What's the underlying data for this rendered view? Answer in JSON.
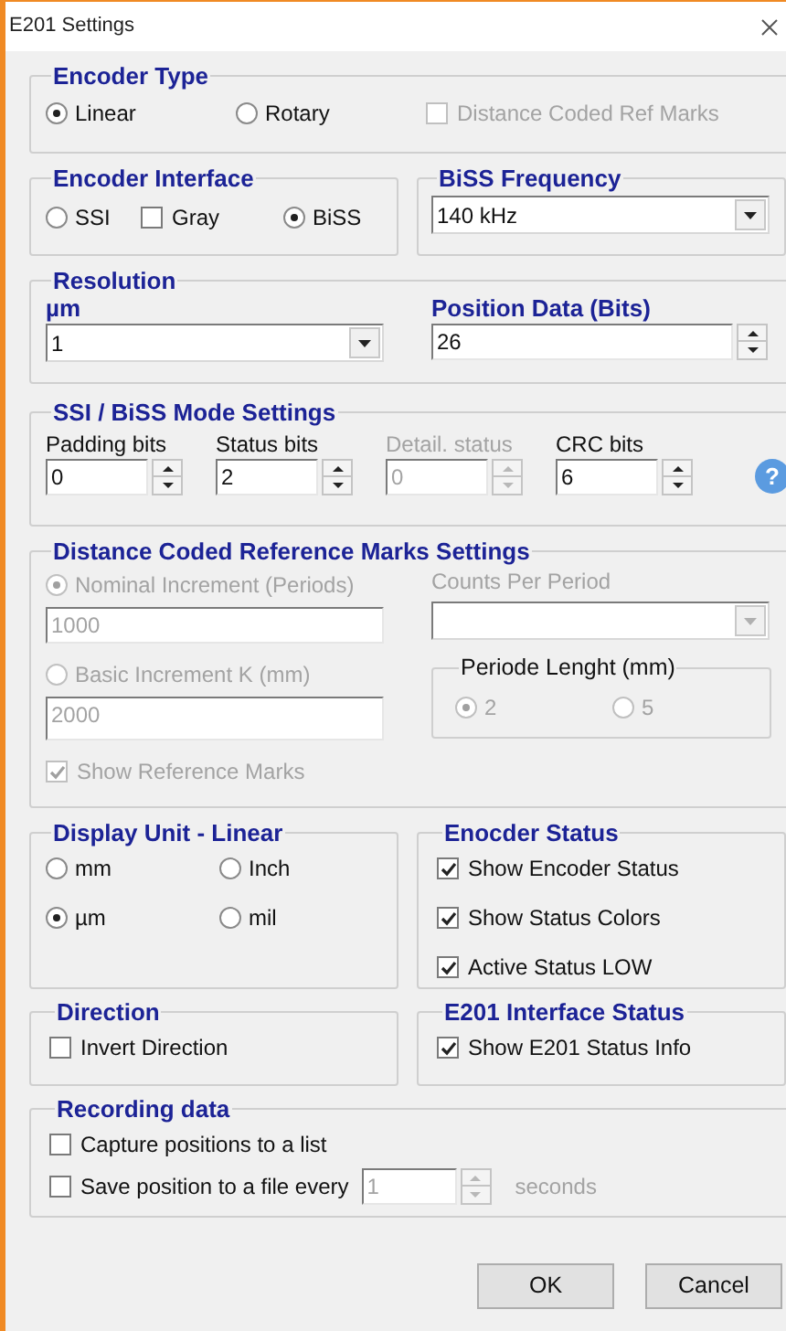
{
  "window": {
    "title": "E201 Settings"
  },
  "encoder_type": {
    "title": "Encoder Type",
    "options": [
      {
        "label": "Linear",
        "selected": true
      },
      {
        "label": "Rotary",
        "selected": false
      }
    ],
    "distance_coded_ref_marks": {
      "label": "Distance Coded Ref Marks",
      "checked": false,
      "disabled": true
    }
  },
  "encoder_interface": {
    "title": "Encoder Interface",
    "options": [
      {
        "label": "SSI",
        "selected": false
      },
      {
        "label": "BiSS",
        "selected": true
      }
    ],
    "gray": {
      "label": "Gray",
      "checked": false
    }
  },
  "biss_frequency": {
    "title": "BiSS Frequency",
    "value": "140 kHz"
  },
  "resolution": {
    "title": "Resolution",
    "unit": {
      "label": "µm",
      "value": "1"
    },
    "position_data": {
      "label": "Position Data (Bits)",
      "value": "26"
    }
  },
  "mode_settings": {
    "title": "SSI / BiSS Mode Settings",
    "help": "?",
    "fields": [
      {
        "label": "Padding bits",
        "value": "0",
        "disabled": false
      },
      {
        "label": "Status bits",
        "value": "2",
        "disabled": false
      },
      {
        "label": "Detail. status",
        "value": "0",
        "disabled": true
      },
      {
        "label": "CRC bits",
        "value": "6",
        "disabled": false
      }
    ]
  },
  "reference_marks": {
    "title": "Distance Coded Reference Marks Settings",
    "disabled": true,
    "increment_options": [
      {
        "label": "Nominal Increment (Periods)",
        "value": "1000",
        "selected": true
      },
      {
        "label": "Basic Increment K (mm)",
        "value": "2000",
        "selected": false
      }
    ],
    "counts_per_period": {
      "label": "Counts Per Period"
    },
    "period_length": {
      "title": "Periode Lenght (mm)",
      "options": [
        {
          "label": "2",
          "selected": true
        },
        {
          "label": "5",
          "selected": false
        }
      ]
    },
    "show_reference_marks": {
      "label": "Show Reference Marks",
      "checked": true
    }
  },
  "display_unit": {
    "title": "Display Unit - Linear",
    "options": [
      {
        "label": "mm",
        "selected": false
      },
      {
        "label": "Inch",
        "selected": false
      },
      {
        "label": "µm",
        "selected": true
      },
      {
        "label": "mil",
        "selected": false
      }
    ]
  },
  "encoder_status": {
    "title": "Enocder Status",
    "items": [
      {
        "label": "Show Encoder Status",
        "checked": true
      },
      {
        "label": "Show Status Colors",
        "checked": true
      },
      {
        "label": "Active Status LOW",
        "checked": true
      }
    ]
  },
  "direction": {
    "title": "Direction",
    "invert": {
      "label": "Invert Direction",
      "checked": false
    }
  },
  "interface_status": {
    "title": "E201 Interface Status",
    "show_info": {
      "label": "Show E201 Status Info",
      "checked": true
    }
  },
  "recording": {
    "title": "Recording data",
    "capture": {
      "label": "Capture positions to a list",
      "checked": false
    },
    "save": {
      "label": "Save position to a file every",
      "checked": false,
      "interval": "1",
      "unit": "seconds"
    }
  },
  "buttons": [
    {
      "label": "OK"
    },
    {
      "label": "Cancel"
    }
  ]
}
